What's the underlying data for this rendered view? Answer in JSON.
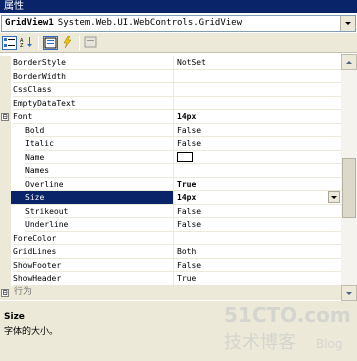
{
  "window": {
    "title": "属性"
  },
  "object_selector": {
    "name": "GridView1",
    "type": "System.Web.UI.WebControls.GridView"
  },
  "toolbar": {
    "icons": [
      "categorized-icon",
      "alphabetical-icon",
      "properties-icon",
      "events-icon",
      "property-pages-icon"
    ]
  },
  "properties": [
    {
      "name": "BorderStyle",
      "value": "NotSet"
    },
    {
      "name": "BorderWidth",
      "value": ""
    },
    {
      "name": "CssClass",
      "value": ""
    },
    {
      "name": "EmptyDataText",
      "value": ""
    },
    {
      "name": "Font",
      "value": "14px",
      "expander": "⊟"
    },
    {
      "name": "Bold",
      "value": "False"
    },
    {
      "name": "Italic",
      "value": "False"
    },
    {
      "name": "Name",
      "value": ""
    },
    {
      "name": "Names",
      "value": ""
    },
    {
      "name": "Overline",
      "value": "True"
    },
    {
      "name": "Size",
      "value": "14px"
    },
    {
      "name": "Strikeout",
      "value": "False"
    },
    {
      "name": "Underline",
      "value": "False"
    },
    {
      "name": "ForeColor",
      "value": ""
    },
    {
      "name": "GridLines",
      "value": "Both"
    },
    {
      "name": "ShowFooter",
      "value": "False"
    },
    {
      "name": "ShowHeader",
      "value": "True"
    }
  ],
  "category": {
    "label": "行为",
    "expander": "⊟"
  },
  "description": {
    "title": "Size",
    "text": "字体的大小。"
  },
  "watermark": {
    "text1": "51CTO.com",
    "text2": "技术博客",
    "text3": "Blog"
  },
  "colors": {
    "selection": "#0a246a",
    "gutter": "#ece9d8",
    "titlebar": "#0a246a"
  }
}
